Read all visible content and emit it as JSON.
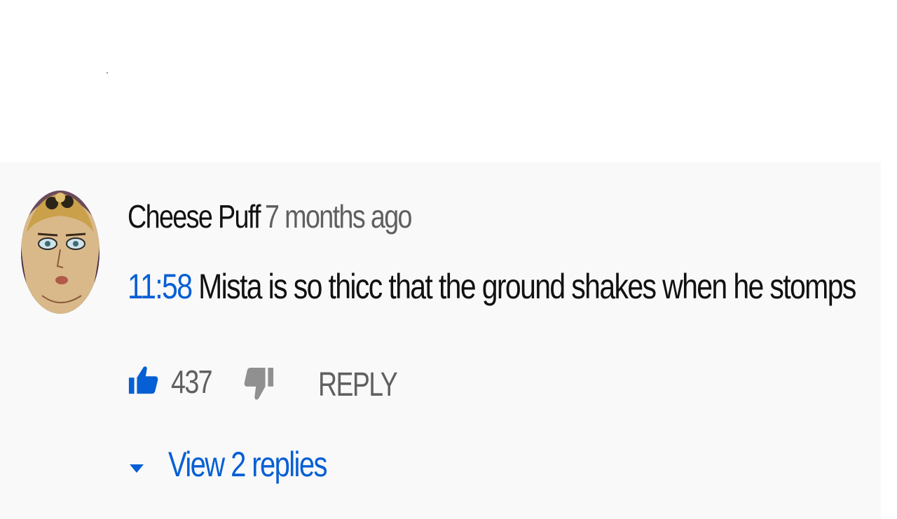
{
  "comment": {
    "author": "Cheese Puff",
    "age": "7 months ago",
    "timestamp_link": "11:58",
    "text": " Mista is so thicc that the ground shakes when he stomps",
    "like_count": "437",
    "reply_label": "REPLY",
    "view_replies_label": "View 2 replies"
  },
  "icons": {
    "like": "thumbs-up-icon",
    "dislike": "thumbs-down-icon",
    "expand": "caret-down-icon",
    "avatar": "avatar-image"
  },
  "colors": {
    "panel_background": "#f9f9f9",
    "link_blue": "#065fd4",
    "secondary_text": "#606060",
    "primary_text": "#111111"
  }
}
